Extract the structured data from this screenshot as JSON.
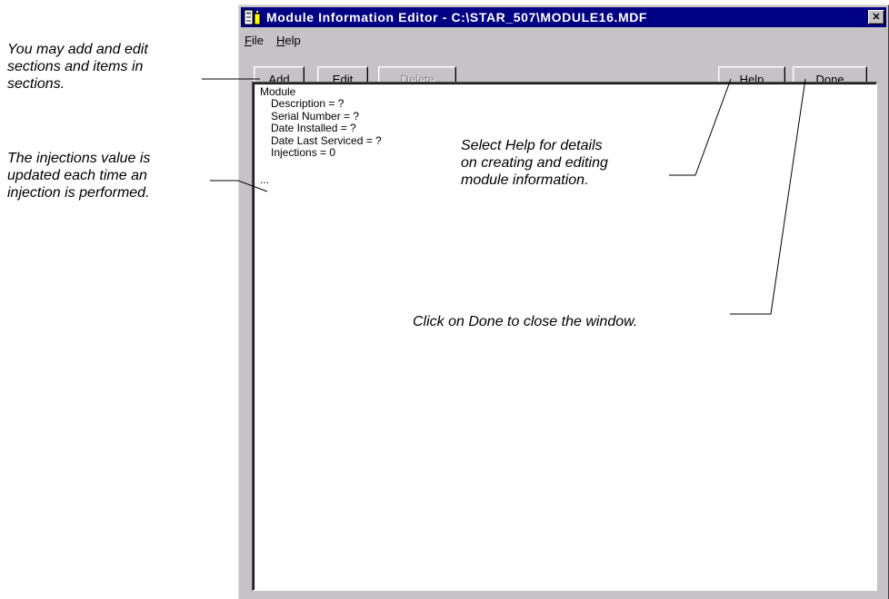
{
  "window": {
    "title": "Module Information Editor - C:\\STAR_507\\MODULE16.MDF",
    "close_glyph": "✕",
    "icon": "app-icon"
  },
  "menu": {
    "items": [
      {
        "accel": "F",
        "rest": "ile"
      },
      {
        "accel": "H",
        "rest": "elp"
      }
    ]
  },
  "toolbar": {
    "add": {
      "accel": "A",
      "rest": "dd"
    },
    "edit": {
      "accel": "E",
      "rest": "dit"
    },
    "delete": {
      "accel": "D",
      "rest": "elete"
    },
    "help": {
      "accel": "H",
      "rest": "elp"
    },
    "done": {
      "pre": "Do",
      "accel": "n",
      "rest": "e"
    }
  },
  "tree": {
    "root": "Module",
    "children": [
      "Description = ?",
      "Serial Number = ?",
      "Date Installed = ?",
      "Date Last Serviced = ?",
      "Injections = 0"
    ],
    "ellipsis": "..."
  },
  "annotations": {
    "add_edit": [
      "You may add and edit",
      "sections and items in",
      "sections."
    ],
    "injections": [
      "The injections value is",
      "updated each time an",
      "injection is performed."
    ],
    "help": [
      "Select Help for details",
      "on creating and editing",
      "module information."
    ],
    "done": "Click on Done to close the window."
  },
  "colors": {
    "titlebar": "#000084",
    "window_face": "#c6c3c6",
    "content_bg": "#ffffff"
  }
}
